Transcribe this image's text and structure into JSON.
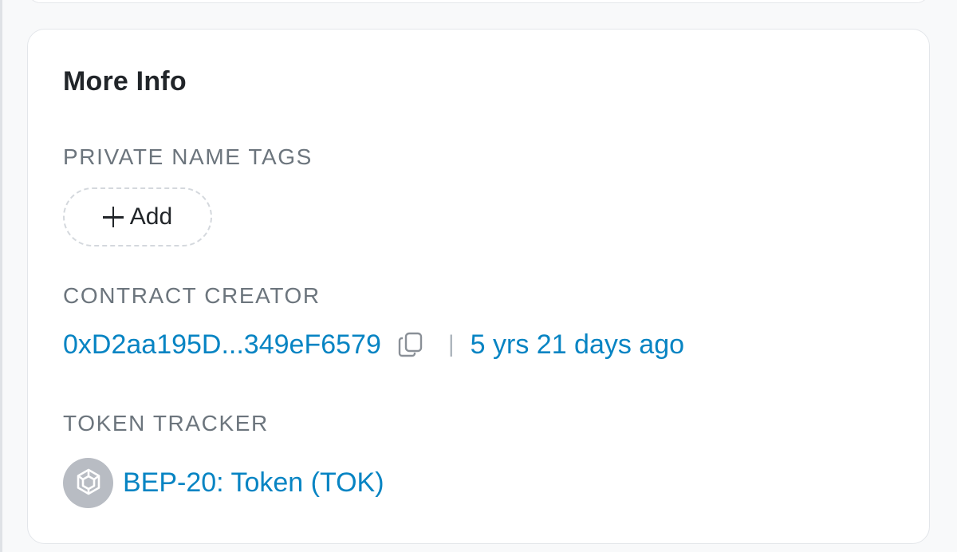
{
  "card": {
    "title": "More Info"
  },
  "private_name_tags": {
    "label": "PRIVATE NAME TAGS",
    "add_label": "Add"
  },
  "contract_creator": {
    "label": "CONTRACT CREATOR",
    "address": "0xD2aa195D...349eF6579",
    "separator": "|",
    "age": "5 yrs 21 days ago"
  },
  "token_tracker": {
    "label": "TOKEN TRACKER",
    "token_name": "BEP-20: Token (TOK)"
  },
  "colors": {
    "link": "#0784c3",
    "label": "#6c757d",
    "title": "#212529",
    "token_logo_bg": "#b8bcc3"
  },
  "icons": {
    "add": "plus-icon",
    "copy": "copy-icon",
    "token": "bnb-token-icon"
  }
}
